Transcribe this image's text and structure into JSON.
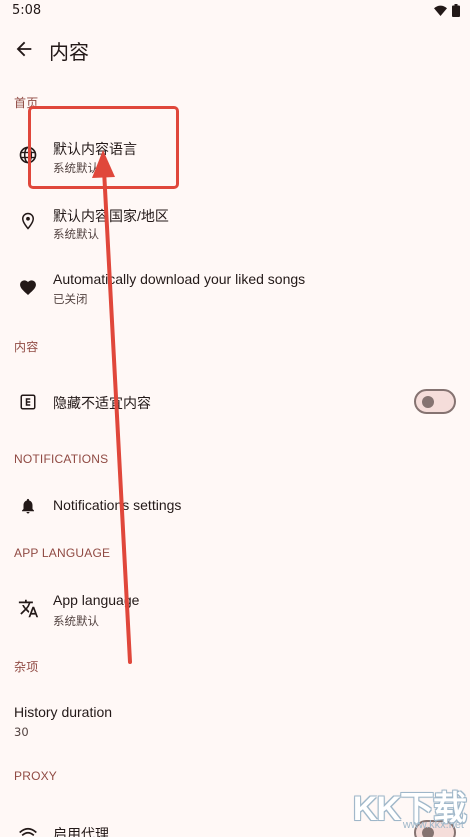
{
  "status_bar": {
    "time": "5:08"
  },
  "app_bar": {
    "title": "内容"
  },
  "sections": {
    "home": "首页",
    "content": "内容",
    "notifications": "NOTIFICATIONS",
    "app_language": "APP LANGUAGE",
    "misc": "杂项",
    "proxy": "PROXY"
  },
  "items": {
    "content_language": {
      "title": "默认内容语言",
      "subtitle": "系统默认"
    },
    "content_country": {
      "title": "默认内容国家/地区",
      "subtitle": "系统默认"
    },
    "auto_download": {
      "title": "Automatically download your liked songs",
      "subtitle": "已关闭"
    },
    "hide_explicit": {
      "title": "隐藏不适宜内容",
      "enabled": false
    },
    "notifications_settings": {
      "title": "Notifications settings"
    },
    "app_language": {
      "title": "App language",
      "subtitle": "系统默认"
    },
    "history_duration": {
      "title": "History duration",
      "value": "30"
    },
    "enable_proxy": {
      "title": "启用代理",
      "enabled": false
    }
  },
  "annotation": {
    "color": "#E0473B"
  },
  "watermark": {
    "main": "KK下载",
    "sub": "www.kkx.net"
  }
}
